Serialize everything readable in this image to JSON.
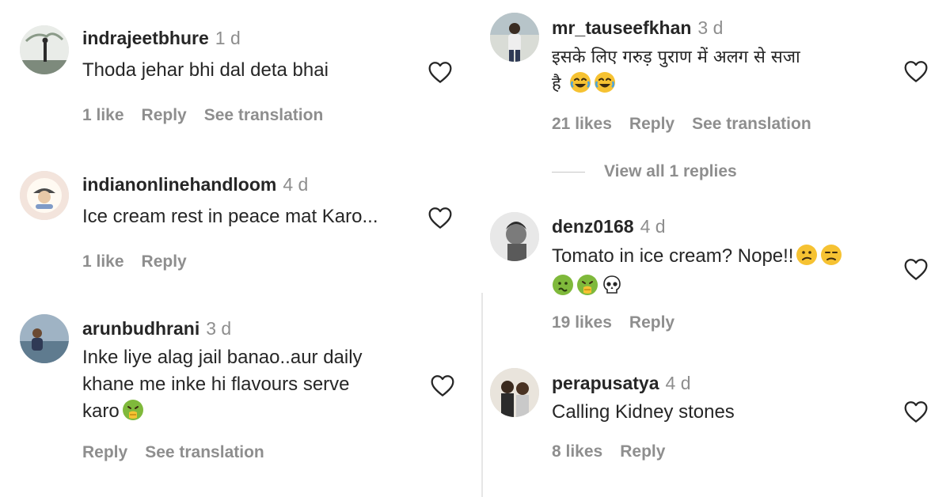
{
  "left_column": [
    {
      "username": "indrajeetbhure",
      "time": "1 d",
      "lines": [
        "Thoda jehar bhi dal deta bhai"
      ],
      "likes": "1 like",
      "reply": "Reply",
      "translation": "See translation"
    },
    {
      "username": "indianonlinehandloom",
      "time": "4 d",
      "lines": [
        "Ice cream rest in peace mat Karo..."
      ],
      "likes": "1 like",
      "reply": "Reply"
    },
    {
      "username": "arunbudhrani",
      "time": "3 d",
      "lines": [
        "Inke liye alag jail banao..aur daily",
        "khane me inke hi flavours serve",
        "karo"
      ],
      "reply": "Reply",
      "translation": "See translation"
    }
  ],
  "right_column": [
    {
      "username": "mr_tauseefkhan",
      "time": "3 d",
      "lines": [
        "इसके लिए गरुड़ पुराण में अलग से सजा",
        "है"
      ],
      "likes": "21 likes",
      "reply": "Reply",
      "translation": "See translation",
      "view_replies": "View all 1 replies"
    },
    {
      "username": "denz0168",
      "time": "4 d",
      "lines": [
        "Tomato in ice cream? Nope!!"
      ],
      "likes": "19 likes",
      "reply": "Reply"
    },
    {
      "username": "perapusatya",
      "time": "4 d",
      "lines": [
        "Calling Kidney stones"
      ],
      "likes": "8 likes",
      "reply": "Reply"
    }
  ],
  "icons": {
    "like": "heart-outline-icon",
    "emoji_laugh": "face-with-tears-of-joy-icon",
    "emoji_confused": "confused-face-icon",
    "emoji_unamused": "unamused-face-icon",
    "emoji_nauseated": "nauseated-face-icon",
    "emoji_vomiting": "face-vomiting-icon",
    "emoji_skull": "skull-icon"
  },
  "colors": {
    "text": "#262626",
    "secondary": "#8e8e8e",
    "emoji_yellow": "#f6c232",
    "emoji_green": "#7fb93b"
  }
}
